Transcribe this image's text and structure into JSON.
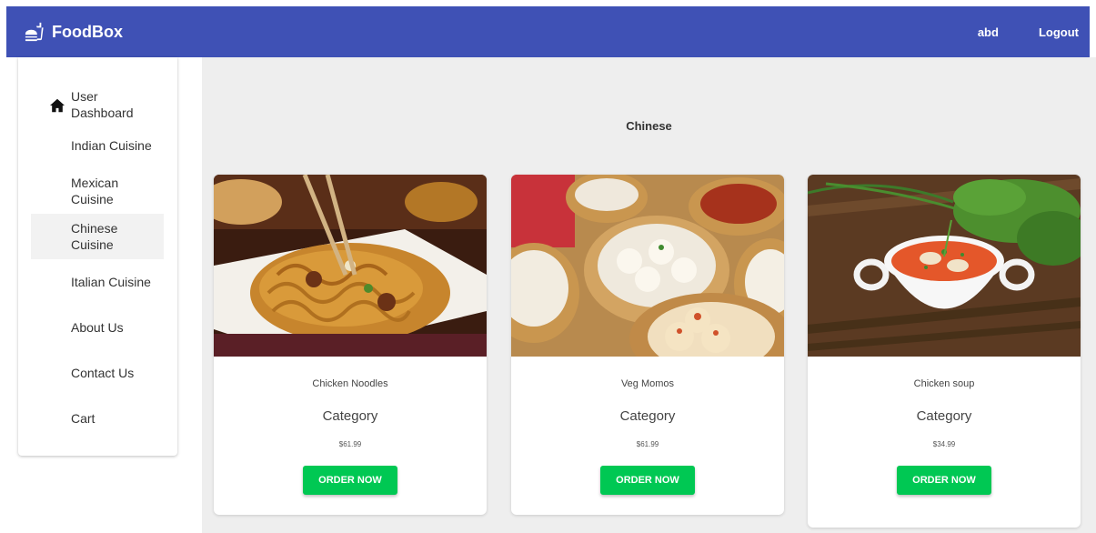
{
  "header": {
    "brand_icon": "fastfood-icon",
    "brand": "FoodBox",
    "username": "abd",
    "logout_label": "Logout",
    "color": "#3f51b5"
  },
  "sidebar": {
    "items": [
      {
        "label": "User Dashboard",
        "icon": "home-icon",
        "active": false
      },
      {
        "label": "Indian Cuisine",
        "active": false
      },
      {
        "label": "Mexican Cuisine",
        "active": false
      },
      {
        "label": "Chinese Cuisine",
        "active": true
      },
      {
        "label": "Italian Cuisine",
        "active": false
      },
      {
        "label": "About Us",
        "active": false
      },
      {
        "label": "Contact Us",
        "active": false
      },
      {
        "label": "Cart",
        "active": false
      }
    ]
  },
  "main": {
    "title": "Chinese",
    "products": [
      {
        "name": "Chicken Noodles",
        "category": "Category",
        "price": "$61.99",
        "button": "ORDER NOW",
        "image": "chicken-noodles-photo"
      },
      {
        "name": "Veg Momos",
        "category": "Category",
        "price": "$61.99",
        "button": "ORDER NOW",
        "image": "veg-momos-photo"
      },
      {
        "name": "Chicken soup",
        "category": "Category",
        "price": "$34.99",
        "button": "ORDER NOW",
        "image": "chicken-soup-photo"
      }
    ]
  },
  "colors": {
    "primary": "#3f51b5",
    "button": "#00c853",
    "background": "#eeeeee"
  }
}
